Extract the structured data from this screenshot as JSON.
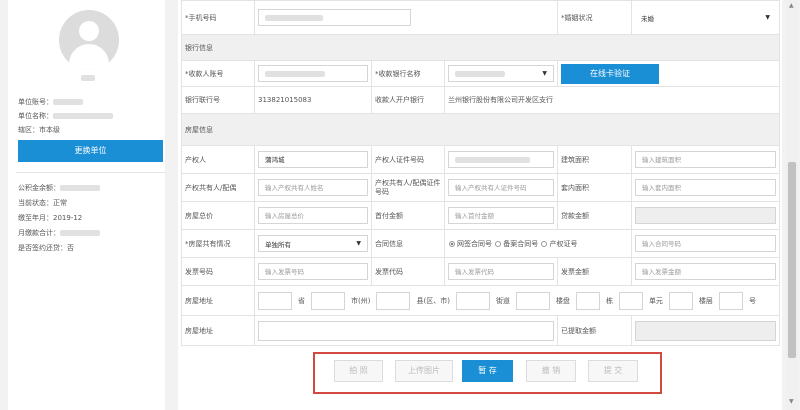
{
  "sidebar": {
    "unit_account_label": "单位账号：",
    "unit_name_label": "单位名称：",
    "district_label": "辖区：",
    "district_value": "市本级",
    "switch_button": "更换单位",
    "fund_balance_label": "公积金余额：",
    "current_status_label": "当前状态：",
    "current_status_value": "正常",
    "paid_to_label": "缴至年月：",
    "paid_to_value": "2019-12",
    "monthly_total_label": "月缴款合计：",
    "signed_repay_label": "是否签约还贷：",
    "signed_repay_value": "否"
  },
  "form": {
    "phone_label": "*手机号码",
    "marital_label": "*婚姻状况",
    "marital_value": "未婚",
    "bank_section": "银行信息",
    "payee_account_label": "*收款人账号",
    "payee_bank_name_label": "*收款银行名称",
    "verify_button": "在线卡验证",
    "bank_code_label": "银行联行号",
    "bank_code_value": "313821015083",
    "payee_bank_label": "收款人开户银行",
    "payee_bank_value": "兰州银行股份有限公司开发区支行",
    "house_section": "房屋信息",
    "owner_label": "产权人",
    "owner_value": "蒲鸿城",
    "owner_id_label": "产权人证件号码",
    "build_area_label": "建筑面积",
    "build_area_placeholder": "输入建筑面积",
    "co_owner_label": "产权共有人/配偶",
    "co_owner_placeholder": "输入产权共有人姓名",
    "co_owner_id_label": "产权共有人/配偶证件号码",
    "co_owner_id_placeholder": "输入产权共有人证件号码",
    "inner_area_label": "套内面积",
    "inner_area_placeholder": "输入套内面积",
    "total_price_label": "房屋总价",
    "total_price_placeholder": "输入房屋总价",
    "down_payment_label": "首付金额",
    "down_payment_placeholder": "输入首付金额",
    "loan_amount_label": "贷款金额",
    "ownership_label": "*房屋共有情况",
    "ownership_value": "单独所有",
    "contract_label": "合同信息",
    "contract_options": [
      "网签合同号",
      "备案合同号",
      "产权证号"
    ],
    "contract_placeholder": "输入合同号码",
    "invoice_no_label": "发票号码",
    "invoice_no_placeholder": "输入发票号码",
    "invoice_code_label": "发票代码",
    "invoice_code_placeholder": "输入发票代码",
    "invoice_amount_label": "发票金额",
    "invoice_amount_placeholder": "输入发票金额",
    "address_label": "房屋地址",
    "address_units": [
      "省",
      "市(州)",
      "县(区、市)",
      "街道",
      "楼盘",
      "栋",
      "单元",
      "楼层",
      "号"
    ],
    "address2_label": "房屋地址",
    "withdrawn_label": "已提取金额"
  },
  "actions": {
    "photo": "拍 照",
    "upload": "上传图片",
    "save": "暂 存",
    "revoke": "撤 销",
    "submit": "提 交"
  }
}
